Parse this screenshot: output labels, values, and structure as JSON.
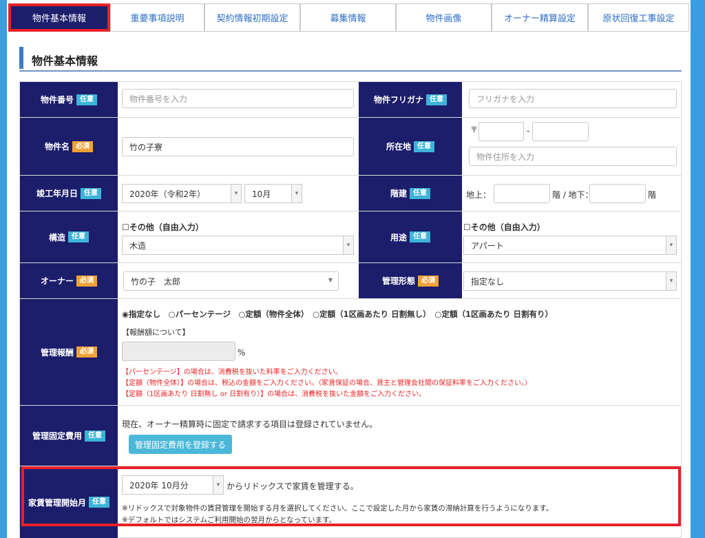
{
  "tabs": [
    {
      "label": "物件基本情報"
    },
    {
      "label": "重要事項説明"
    },
    {
      "label": "契約情報初期設定"
    },
    {
      "label": "募集情報"
    },
    {
      "label": "物件画像"
    },
    {
      "label": "オーナー精算設定"
    },
    {
      "label": "原状回復工事設定"
    }
  ],
  "section_title": "物件基本情報",
  "badges": {
    "optional": "任意",
    "required": "必須"
  },
  "fields": {
    "property_number": {
      "label": "物件番号",
      "placeholder": "物件番号を入力"
    },
    "furigana": {
      "label": "物件フリガナ",
      "placeholder": "フリガナを入力"
    },
    "property_name": {
      "label": "物件名",
      "value": "竹の子寮"
    },
    "address": {
      "label": "所在地",
      "postal_mark": "〒",
      "postal_sep": "-",
      "placeholder": "物件住所を入力"
    },
    "built_date": {
      "label": "竣工年月日",
      "year": "2020年（令和2年）",
      "month": "10月"
    },
    "floors": {
      "label": "階建",
      "above": "地上：",
      "below": "階 / 地下：",
      "suffix": "階"
    },
    "structure": {
      "label": "構造",
      "other": "☐その他（自由入力）",
      "value": "木造"
    },
    "usage": {
      "label": "用途",
      "other": "☐その他（自由入力）",
      "value": "アパート"
    },
    "owner": {
      "label": "オーナー",
      "value": "竹の子　太郎"
    },
    "management_type": {
      "label": "管理形態",
      "value": "指定なし"
    },
    "management_fee": {
      "label": "管理報酬",
      "options": "◉指定なし　○パーセンテージ　○定額（物件全体）　○定額（1区画あたり 日割無し）　○定額（1区画あたり 日割有り）",
      "about": "【報酬額について】",
      "unit": "%",
      "notes": [
        "【パーセンテージ】の場合は、消費税を抜いた料率をご入力ください。",
        "【定額（物件全体）】の場合は、税込の金額をご入力ください。（家賃保証の場合、賃主と管理会社間の保証料率をご入力ください。）",
        "【定額（1区画あたり 日割無し or 日割有り）】の場合は、消費税を抜いた金額をご入力ください。"
      ]
    },
    "fixed_cost": {
      "label": "管理固定費用",
      "message": "現在、オーナー精算時に固定で請求する項目は登録されていません。",
      "button": "管理固定費用を登録する"
    },
    "rent_start": {
      "label": "家賃管理開始月",
      "value": "2020年 10月分",
      "suffix": "からリドックスで家賃を管理する。",
      "note1": "※リドックスで対象物件の賃貸管理を開始する月を選択してください。ここで設定した月から家賃の滞納計算を行うようになります。",
      "note2": "※デフォルトではシステムご利用開始の翌月からとなっています。"
    }
  },
  "colors": {
    "header_bg": "#1c1d6b",
    "highlight": "#e8202a",
    "optional_badge": "#3cb4d8",
    "required_badge": "#f0a238",
    "button": "#4cb8d9"
  }
}
